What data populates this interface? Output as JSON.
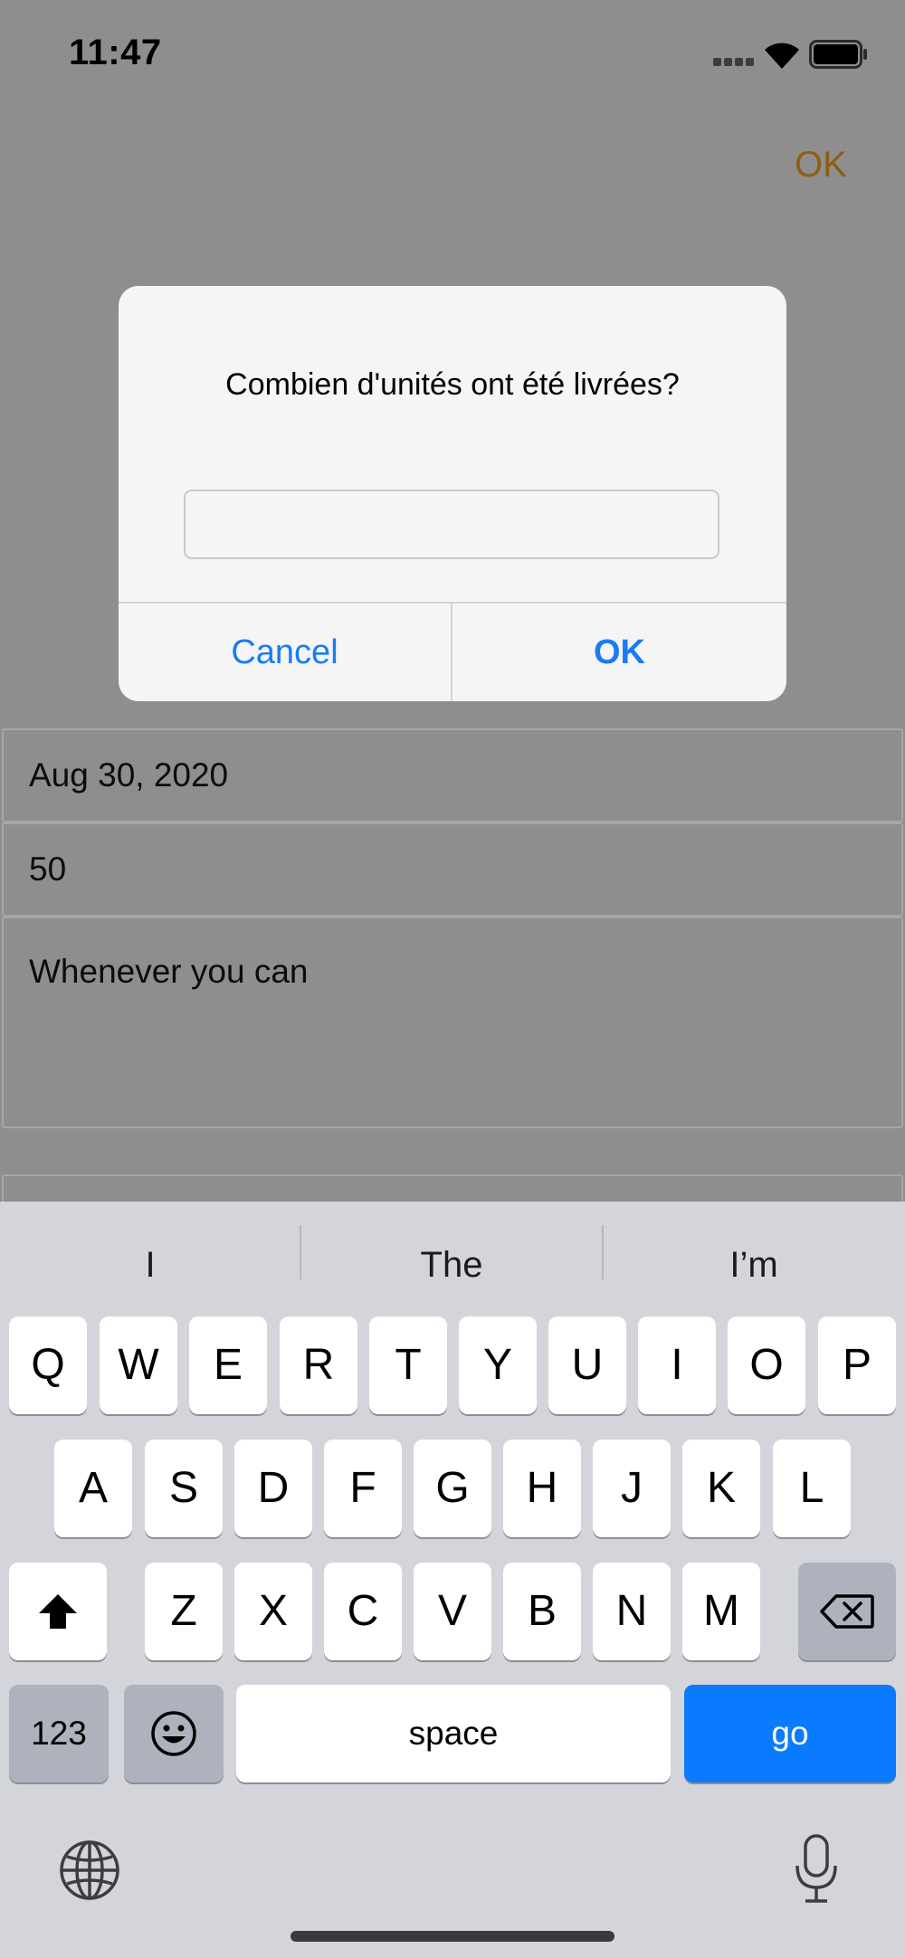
{
  "status_bar": {
    "time": "11:47"
  },
  "nav": {
    "ok_label": "OK"
  },
  "form": {
    "date": "Aug 30, 2020",
    "quantity": "50",
    "note": "Whenever you can"
  },
  "alert": {
    "title": "Combien d'unités ont été livrées?",
    "input_value": "",
    "cancel_label": "Cancel",
    "ok_label": "OK"
  },
  "keyboard": {
    "suggestions": [
      "I",
      "The",
      "I’m"
    ],
    "row1": [
      "Q",
      "W",
      "E",
      "R",
      "T",
      "Y",
      "U",
      "I",
      "O",
      "P"
    ],
    "row2": [
      "A",
      "S",
      "D",
      "F",
      "G",
      "H",
      "J",
      "K",
      "L"
    ],
    "row3": [
      "Z",
      "X",
      "C",
      "V",
      "B",
      "N",
      "M"
    ],
    "numbers_label": "123",
    "space_label": "space",
    "go_label": "go"
  },
  "colors": {
    "accent": "#1a7cf4",
    "go_key": "#0a7aff",
    "nav_ok": "#8f5d12"
  },
  "icons": {
    "shift": "shift-icon",
    "delete": "delete-icon",
    "emoji": "emoji-icon",
    "globe": "globe-icon",
    "mic": "mic-icon"
  }
}
